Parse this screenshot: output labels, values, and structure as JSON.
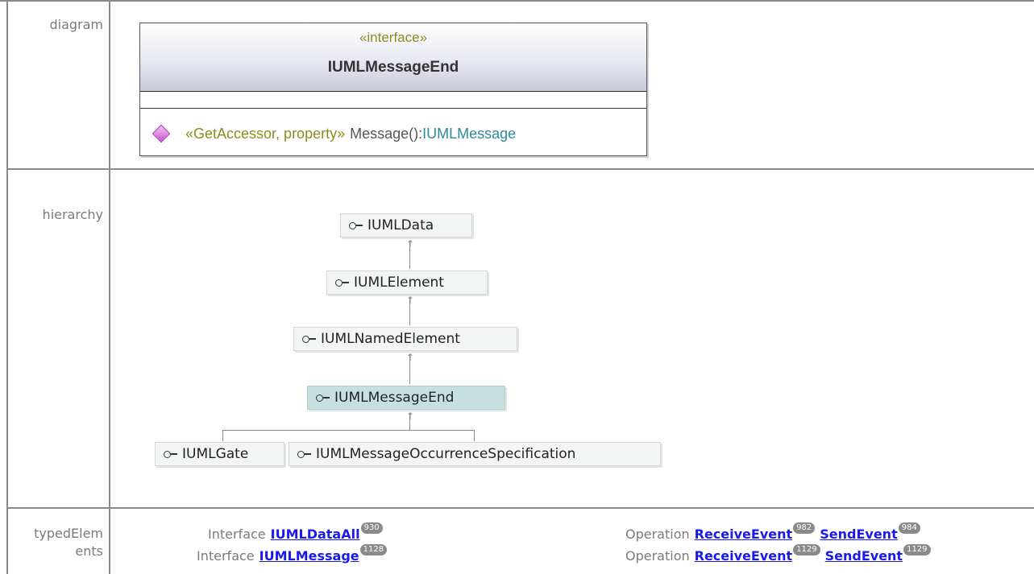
{
  "rows": {
    "diagram_label": "diagram",
    "hierarchy_label": "hierarchy",
    "typed_label_line1": "typedElem",
    "typed_label_line2": "ents"
  },
  "class_box": {
    "stereotype": "«interface»",
    "name": "IUMLMessageEnd",
    "operation": {
      "icon": "operation-diamond-icon",
      "stereotype": "«GetAccessor, property»",
      "name": "Message():",
      "return_type": "IUMLMessage"
    }
  },
  "hierarchy": {
    "icon": "interface-lollipop-icon",
    "nodes": {
      "data": "IUMLData",
      "element": "IUMLElement",
      "named_element": "IUMLNamedElement",
      "message_end": "IUMLMessageEnd",
      "gate": "IUMLGate",
      "occurrence_spec": "IUMLMessageOccurrenceSpecification"
    },
    "current": "IUMLMessageEnd"
  },
  "typed_elements": {
    "left": [
      {
        "kind": "Interface",
        "link": "IUMLDataAll",
        "page": "930"
      },
      {
        "kind": "Interface",
        "link": "IUMLMessage",
        "page": "1128"
      }
    ],
    "right": [
      {
        "kind": "Operation",
        "link1": "ReceiveEvent",
        "page1": "982",
        "link2": "SendEvent",
        "page2": "984"
      },
      {
        "kind": "Operation",
        "link1": "ReceiveEvent",
        "page1": "1129",
        "link2": "SendEvent",
        "page2": "1129"
      }
    ]
  },
  "colors": {
    "link": "#1a1aee",
    "stereotype": "#8c8c1c",
    "return_type": "#2a8a9a",
    "current_node": "#c6e0e0",
    "grid": "#8a8a8a"
  }
}
